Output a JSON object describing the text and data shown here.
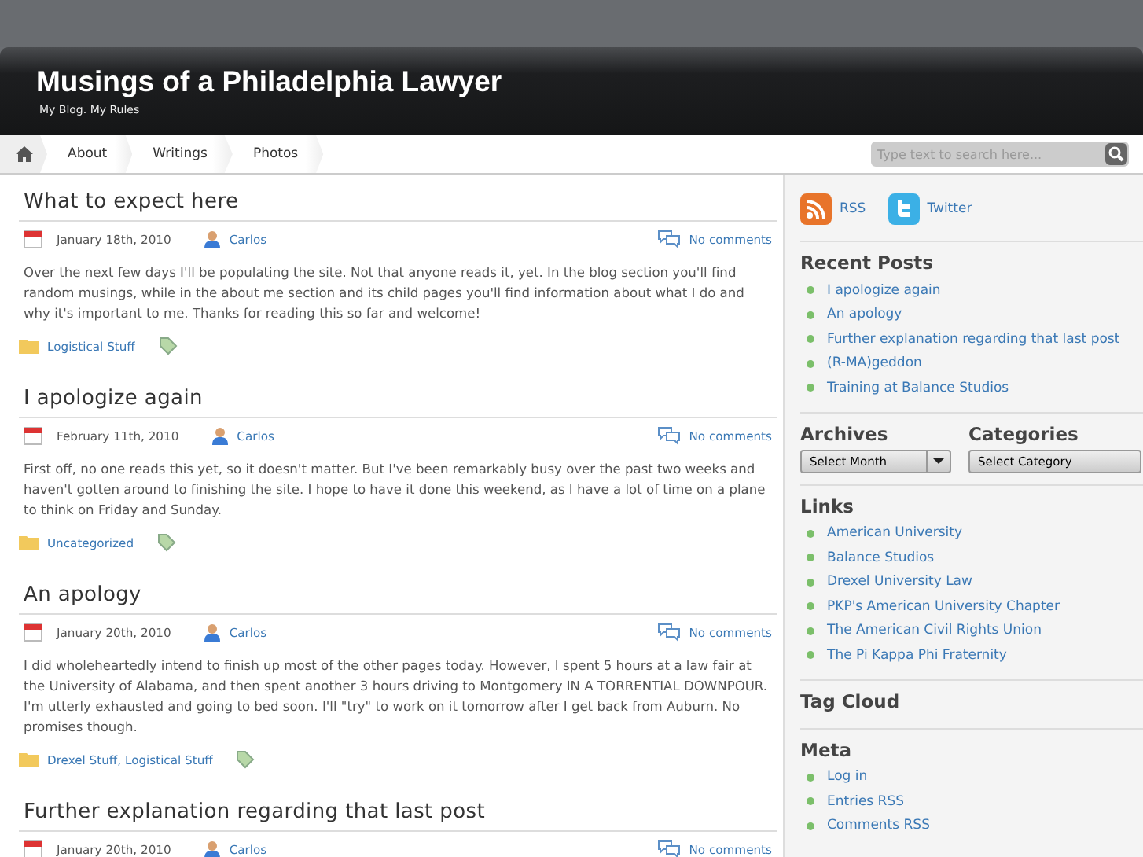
{
  "site": {
    "title": "Musings of a Philadelphia Lawyer",
    "tagline": "My Blog. My Rules"
  },
  "nav": {
    "items": [
      {
        "label": "About"
      },
      {
        "label": "Writings"
      },
      {
        "label": "Photos"
      }
    ],
    "search": {
      "placeholder": "Type text to search here..."
    }
  },
  "posts": [
    {
      "title": "What to expect here",
      "date": "January 18th, 2010",
      "author": "Carlos",
      "comments": "No comments",
      "body": "Over the next few days I'll be populating the site. Not that anyone reads it, yet. In the blog section you'll find random musings, while in the about me section and its child pages you'll find information about what I do and why it's important to me. Thanks for reading this so far and welcome!",
      "categories": "Logistical Stuff"
    },
    {
      "title": "I apologize again",
      "date": "February 11th, 2010",
      "author": "Carlos",
      "comments": "No comments",
      "body": "First off, no one reads this yet, so it doesn't matter. But I've been remarkably busy over the past two weeks and haven't gotten around to finishing the site. I hope to have it done this weekend, as I have a lot of time on a plane to think on Friday and Sunday.",
      "categories": "Uncategorized"
    },
    {
      "title": "An apology",
      "date": "January 20th, 2010",
      "author": "Carlos",
      "comments": "No comments",
      "body": "I did wholeheartedly intend to finish up most of the other pages today. However, I spent 5 hours at a law fair at the University of Alabama, and then spent another 3 hours driving to Montgomery IN A TORRENTIAL DOWNPOUR. I'm utterly exhausted and going to bed soon. I'll \"try\" to work on it tomorrow after I get back from Auburn. No promises though.",
      "categories": "Drexel Stuff, Logistical Stuff"
    },
    {
      "title": "Further explanation regarding that last post",
      "date": "January 20th, 2010",
      "author": "Carlos",
      "comments": "No comments"
    }
  ],
  "sidebar": {
    "feeds": [
      {
        "kind": "rss",
        "label": "RSS"
      },
      {
        "kind": "twitter",
        "label": "Twitter"
      }
    ],
    "recent_posts": {
      "title": "Recent Posts",
      "items": [
        "I apologize again",
        "An apology",
        "Further explanation regarding that last post",
        "(R-MA)geddon",
        "Training at Balance Studios"
      ]
    },
    "archives": {
      "title": "Archives",
      "select": "Select Month"
    },
    "categories": {
      "title": "Categories",
      "select": "Select Category"
    },
    "links": {
      "title": "Links",
      "items": [
        "American University",
        "Balance Studios",
        "Drexel University Law",
        "PKP's American University Chapter",
        "The American Civil Rights Union",
        "The Pi Kappa Phi Fraternity"
      ]
    },
    "tag_cloud": {
      "title": "Tag Cloud"
    },
    "meta": {
      "title": "Meta",
      "items": [
        "Log in",
        "Entries RSS",
        "Comments RSS"
      ]
    }
  }
}
